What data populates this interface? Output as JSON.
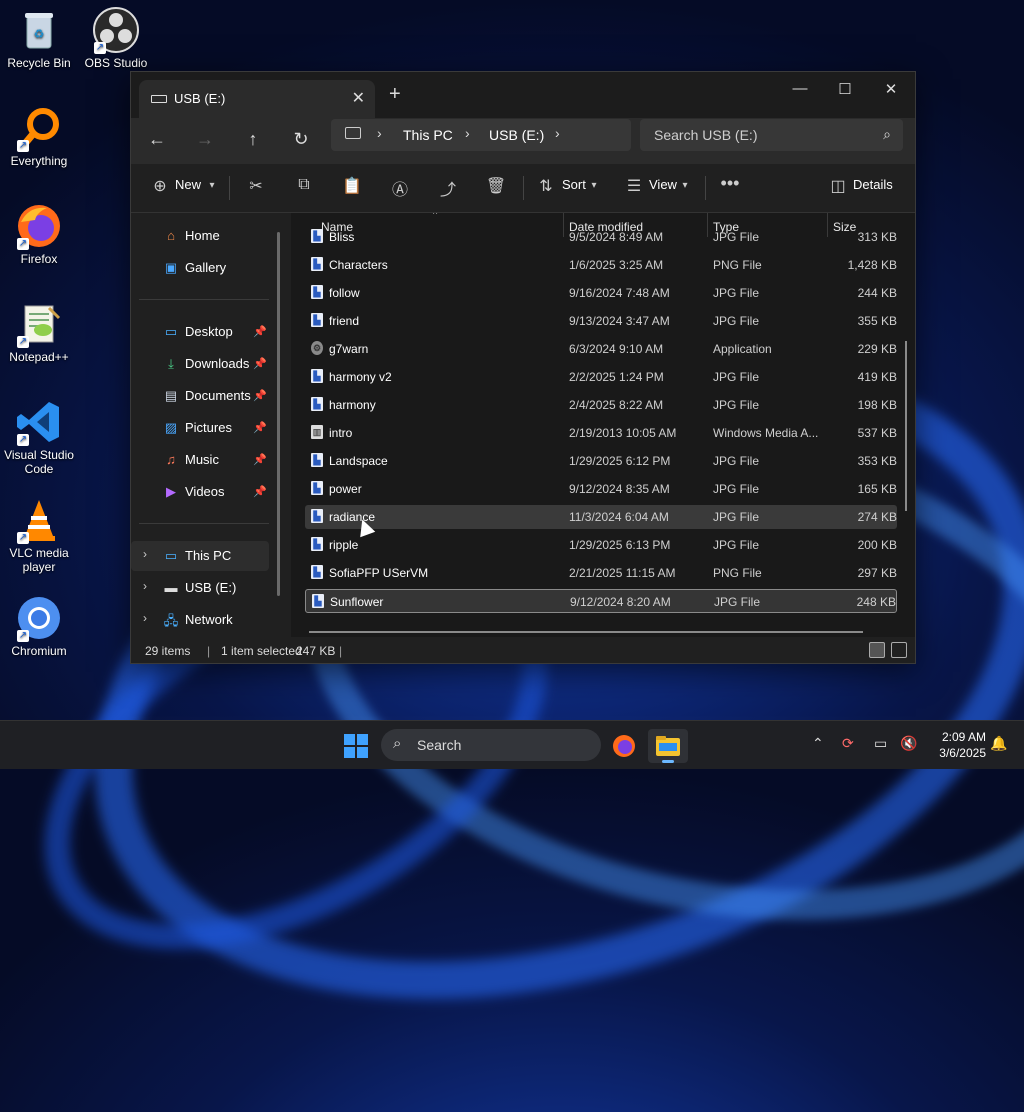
{
  "desktop": {
    "icons": [
      {
        "label": "Recycle Bin"
      },
      {
        "label": "OBS Studio"
      },
      {
        "label": "Everything"
      },
      {
        "label": "Firefox"
      },
      {
        "label": "Notepad++"
      },
      {
        "label": "Visual Studio Code"
      },
      {
        "label": "VLC media player"
      },
      {
        "label": "Chromium"
      }
    ]
  },
  "window": {
    "tab_title": "USB (E:)",
    "breadcrumb": [
      "This PC",
      "USB (E:)"
    ],
    "search_placeholder": "Search USB (E:)",
    "toolbar": {
      "new": "New",
      "sort": "Sort",
      "view": "View",
      "details": "Details"
    },
    "sidebar": {
      "top": [
        {
          "label": "Home"
        },
        {
          "label": "Gallery"
        }
      ],
      "quick": [
        {
          "label": "Desktop"
        },
        {
          "label": "Downloads"
        },
        {
          "label": "Documents"
        },
        {
          "label": "Pictures"
        },
        {
          "label": "Music"
        },
        {
          "label": "Videos"
        }
      ],
      "tree": [
        {
          "label": "This PC"
        },
        {
          "label": "USB (E:)"
        },
        {
          "label": "Network"
        }
      ]
    },
    "columns": {
      "name": "Name",
      "date": "Date modified",
      "type": "Type",
      "size": "Size"
    },
    "files": [
      {
        "name": "Bliss",
        "date": "9/5/2024 8:49 AM",
        "type": "JPG File",
        "size": "313 KB"
      },
      {
        "name": "Characters",
        "date": "1/6/2025 3:25 AM",
        "type": "PNG File",
        "size": "1,428 KB"
      },
      {
        "name": "follow",
        "date": "9/16/2024 7:48 AM",
        "type": "JPG File",
        "size": "244 KB"
      },
      {
        "name": "friend",
        "date": "9/13/2024 3:47 AM",
        "type": "JPG File",
        "size": "355 KB"
      },
      {
        "name": "g7warn",
        "date": "6/3/2024 9:10 AM",
        "type": "Application",
        "size": "229 KB"
      },
      {
        "name": "harmony v2",
        "date": "2/2/2025 1:24 PM",
        "type": "JPG File",
        "size": "419 KB"
      },
      {
        "name": "harmony",
        "date": "2/4/2025 8:22 AM",
        "type": "JPG File",
        "size": "198 KB"
      },
      {
        "name": "intro",
        "date": "2/19/2013 10:05 AM",
        "type": "Windows Media A...",
        "size": "537 KB"
      },
      {
        "name": "Landspace",
        "date": "1/29/2025 6:12 PM",
        "type": "JPG File",
        "size": "353 KB"
      },
      {
        "name": "power",
        "date": "9/12/2024 8:35 AM",
        "type": "JPG File",
        "size": "165 KB"
      },
      {
        "name": "radiance",
        "date": "11/3/2024 6:04 AM",
        "type": "JPG File",
        "size": "274 KB"
      },
      {
        "name": "ripple",
        "date": "1/29/2025 6:13 PM",
        "type": "JPG File",
        "size": "200 KB"
      },
      {
        "name": "SofiaPFP USerVM",
        "date": "2/21/2025 11:15 AM",
        "type": "PNG File",
        "size": "297 KB"
      },
      {
        "name": "Sunflower",
        "date": "9/12/2024 8:20 AM",
        "type": "JPG File",
        "size": "248 KB"
      }
    ],
    "status": {
      "count": "29 items",
      "selected": "1 item selected",
      "size": "247 KB"
    }
  },
  "taskbar": {
    "search_placeholder": "Search",
    "time": "2:09 AM",
    "date": "3/6/2025"
  }
}
